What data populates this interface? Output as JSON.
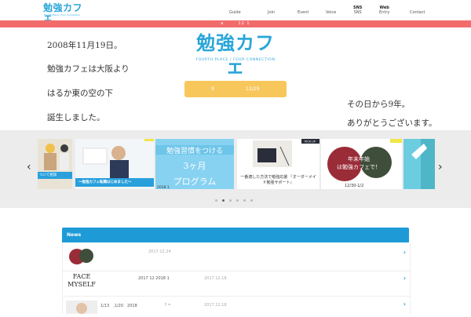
{
  "header": {
    "logo_text": "勉強カフェ",
    "logo_sub": "Fourth Place / Four Connection",
    "nav": [
      {
        "top": "",
        "label": "Guide"
      },
      {
        "top": "",
        "label": "Join"
      },
      {
        "top": "",
        "label": "Event"
      },
      {
        "top": "",
        "label": "Voice"
      },
      {
        "top": "SNS",
        "label": "SNS"
      },
      {
        "top": "Web",
        "label": "Entry"
      },
      {
        "top": "",
        "label": "Contact"
      }
    ]
  },
  "banner": {
    "text": "a　　　12 1"
  },
  "hero": {
    "left_lines": [
      "2008年11月19日。",
      "勉強カフェは大阪より",
      "はるか東の空の下",
      "誕生しました。"
    ],
    "right_lines": [
      "その日から9年。",
      "ありがとうございます。"
    ],
    "logo_text": "勉強カフェ",
    "logo_sub": "FOURTH PLACE / FOUR CONNECTION",
    "countdown_left": "9",
    "countdown_right": "12/29"
  },
  "carousel": {
    "slides": [
      {
        "caption": "ついて相談",
        "title": ""
      },
      {
        "caption": "〜勉強カフェ転職はじめました〜",
        "title": "勉強カフェ転職"
      },
      {
        "caption": "2018 1",
        "title": "勉強習慣をつける　3ヶ月　プログラム"
      },
      {
        "caption": "一番適した方法で勉強応援 『オーダーメイド勉強サポート』",
        "title": "PICK UP"
      },
      {
        "caption": "12/30-1/2",
        "title": "年末年始は勉強カフェで！"
      },
      {
        "caption": "",
        "title": ""
      }
    ],
    "dots": 6,
    "active_dot": 1
  },
  "news": {
    "title": "News",
    "items": [
      {
        "text": "",
        "date": "2017.12.24",
        "thumb_label": "年末年始は勉強カフェで"
      },
      {
        "text": "2017 12 2018 1",
        "date": "2017.12.18",
        "thumb_label": "FACE MYSELF"
      },
      {
        "text": "1/13　,1/20　2018",
        "date": "2017.12.18",
        "middle": "! ~",
        "thumb_label": ""
      }
    ]
  },
  "colors": {
    "brand": "#2aa6d8",
    "banner": "#f26b6b",
    "countdown": "#f7c75c",
    "news_header": "#1e9bd7"
  }
}
